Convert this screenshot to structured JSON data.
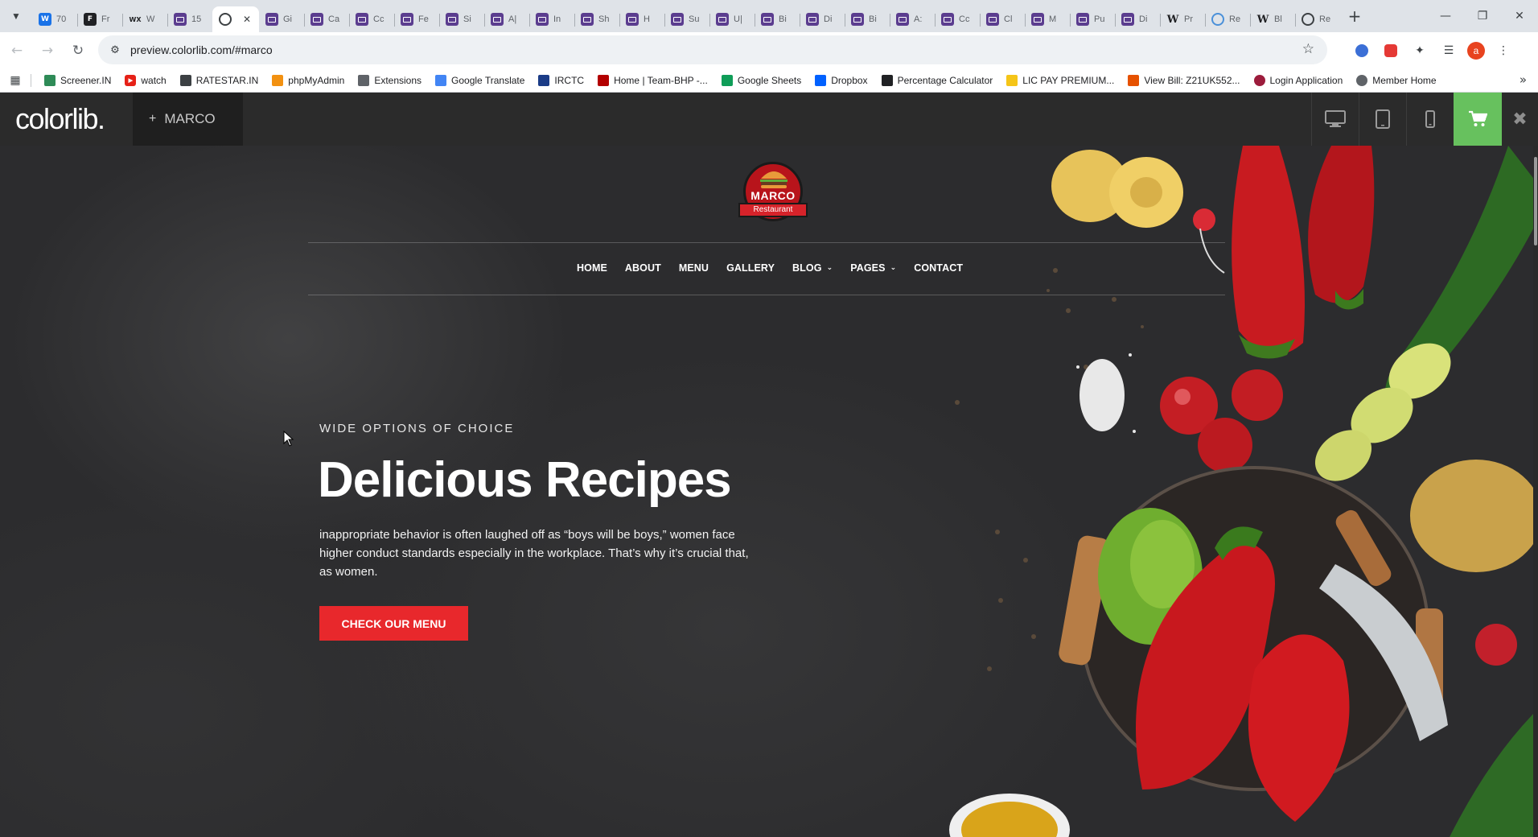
{
  "browser": {
    "tabs": [
      {
        "title": "70",
        "icon": "tab-icon-blue-w",
        "color": "#1a73e8",
        "glyph": "W"
      },
      {
        "title": "Fr",
        "icon": "tab-icon-feather",
        "color": "#202124",
        "glyph": "F"
      },
      {
        "title": "W",
        "icon": "tab-icon-wix",
        "color": "#ffffff",
        "glyph": "WX"
      },
      {
        "title": "15",
        "icon": "tab-icon-colorlib",
        "color": "#5b3d8f",
        "glyph": ""
      },
      {
        "title": "",
        "icon": "tab-icon-globe",
        "color": "#ffffff",
        "glyph": "",
        "active": true
      },
      {
        "title": "Gi",
        "icon": "tab-icon-colorlib",
        "color": "#5b3d8f",
        "glyph": ""
      },
      {
        "title": "Ca",
        "icon": "tab-icon-colorlib",
        "color": "#5b3d8f",
        "glyph": ""
      },
      {
        "title": "Cc",
        "icon": "tab-icon-colorlib",
        "color": "#5b3d8f",
        "glyph": ""
      },
      {
        "title": "Fe",
        "icon": "tab-icon-colorlib",
        "color": "#5b3d8f",
        "glyph": ""
      },
      {
        "title": "Si",
        "icon": "tab-icon-colorlib",
        "color": "#5b3d8f",
        "glyph": ""
      },
      {
        "title": "A|",
        "icon": "tab-icon-colorlib",
        "color": "#5b3d8f",
        "glyph": ""
      },
      {
        "title": "In",
        "icon": "tab-icon-colorlib",
        "color": "#5b3d8f",
        "glyph": ""
      },
      {
        "title": "Sh",
        "icon": "tab-icon-colorlib",
        "color": "#5b3d8f",
        "glyph": ""
      },
      {
        "title": "H",
        "icon": "tab-icon-colorlib",
        "color": "#5b3d8f",
        "glyph": ""
      },
      {
        "title": "Su",
        "icon": "tab-icon-colorlib",
        "color": "#5b3d8f",
        "glyph": ""
      },
      {
        "title": "U|",
        "icon": "tab-icon-colorlib",
        "color": "#5b3d8f",
        "glyph": ""
      },
      {
        "title": "Bi",
        "icon": "tab-icon-colorlib",
        "color": "#5b3d8f",
        "glyph": ""
      },
      {
        "title": "Di",
        "icon": "tab-icon-colorlib",
        "color": "#5b3d8f",
        "glyph": ""
      },
      {
        "title": "Bi",
        "icon": "tab-icon-colorlib",
        "color": "#5b3d8f",
        "glyph": ""
      },
      {
        "title": "A:",
        "icon": "tab-icon-colorlib",
        "color": "#5b3d8f",
        "glyph": ""
      },
      {
        "title": "Cc",
        "icon": "tab-icon-colorlib",
        "color": "#5b3d8f",
        "glyph": ""
      },
      {
        "title": "Cl",
        "icon": "tab-icon-colorlib",
        "color": "#5b3d8f",
        "glyph": ""
      },
      {
        "title": "M",
        "icon": "tab-icon-colorlib",
        "color": "#5b3d8f",
        "glyph": ""
      },
      {
        "title": "Pu",
        "icon": "tab-icon-colorlib",
        "color": "#5b3d8f",
        "glyph": ""
      },
      {
        "title": "Di",
        "icon": "tab-icon-colorlib",
        "color": "#5b3d8f",
        "glyph": ""
      },
      {
        "title": "Pr",
        "icon": "tab-icon-wikipedia",
        "color": "#ffffff",
        "glyph": "W"
      },
      {
        "title": "Re",
        "icon": "tab-icon-globe-blue",
        "color": "#4a90d9",
        "glyph": ""
      },
      {
        "title": "Bl",
        "icon": "tab-icon-wikipedia",
        "color": "#ffffff",
        "glyph": "W"
      },
      {
        "title": "Re",
        "icon": "tab-icon-wordpress",
        "color": "#3c4043",
        "glyph": ""
      }
    ],
    "url": "preview.colorlib.com/#marco",
    "avatar_letter": "a"
  },
  "bookmarks": [
    {
      "label": "Screener.IN",
      "icon": "screener-icon",
      "color": "#2e8b57"
    },
    {
      "label": "watch",
      "icon": "youtube-icon",
      "color": "#e62117"
    },
    {
      "label": "RATESTAR.IN",
      "icon": "ratestar-icon",
      "color": "#3c4043"
    },
    {
      "label": "phpMyAdmin",
      "icon": "phpmyadmin-icon",
      "color": "#f29111"
    },
    {
      "label": "Extensions",
      "icon": "puzzle-icon",
      "color": "#5f6368"
    },
    {
      "label": "Google Translate",
      "icon": "translate-icon",
      "color": "#4285f4"
    },
    {
      "label": "IRCTC",
      "icon": "irctc-icon",
      "color": "#1b3c87"
    },
    {
      "label": "Home | Team-BHP -...",
      "icon": "teambhp-icon",
      "color": "#b30000"
    },
    {
      "label": "Google Sheets",
      "icon": "sheets-icon",
      "color": "#0f9d58"
    },
    {
      "label": "Dropbox",
      "icon": "dropbox-icon",
      "color": "#0061ff"
    },
    {
      "label": "Percentage Calculator",
      "icon": "calculator-icon",
      "color": "#202124"
    },
    {
      "label": "LIC PAY PREMIUM...",
      "icon": "lic-icon",
      "color": "#f5c518"
    },
    {
      "label": "View Bill: Z21UK552...",
      "icon": "bill-icon",
      "color": "#e65100"
    },
    {
      "label": "Login Application",
      "icon": "login-icon",
      "color": "#9c1c3c"
    },
    {
      "label": "Member Home",
      "icon": "globe-icon",
      "color": "#5f6368"
    }
  ],
  "colorlib_bar": {
    "logo": "colorlib.",
    "theme_name": "MARCO",
    "accent": "#67c15e"
  },
  "site": {
    "logo_name": "MARCO",
    "logo_tagline": "Restaurant",
    "nav": [
      {
        "label": "HOME",
        "dropdown": false
      },
      {
        "label": "ABOUT",
        "dropdown": false
      },
      {
        "label": "MENU",
        "dropdown": false
      },
      {
        "label": "GALLERY",
        "dropdown": false
      },
      {
        "label": "BLOG",
        "dropdown": true
      },
      {
        "label": "PAGES",
        "dropdown": true
      },
      {
        "label": "CONTACT",
        "dropdown": false
      }
    ],
    "hero": {
      "subtitle": "WIDE OPTIONS OF CHOICE",
      "title": "Delicious Recipes",
      "text": "inappropriate behavior is often laughed off as “boys will be boys,” women face higher conduct standards especially in the workplace. That’s why it’s crucial that, as women.",
      "button": "CHECK OUR MENU",
      "button_color": "#e8282c"
    }
  }
}
